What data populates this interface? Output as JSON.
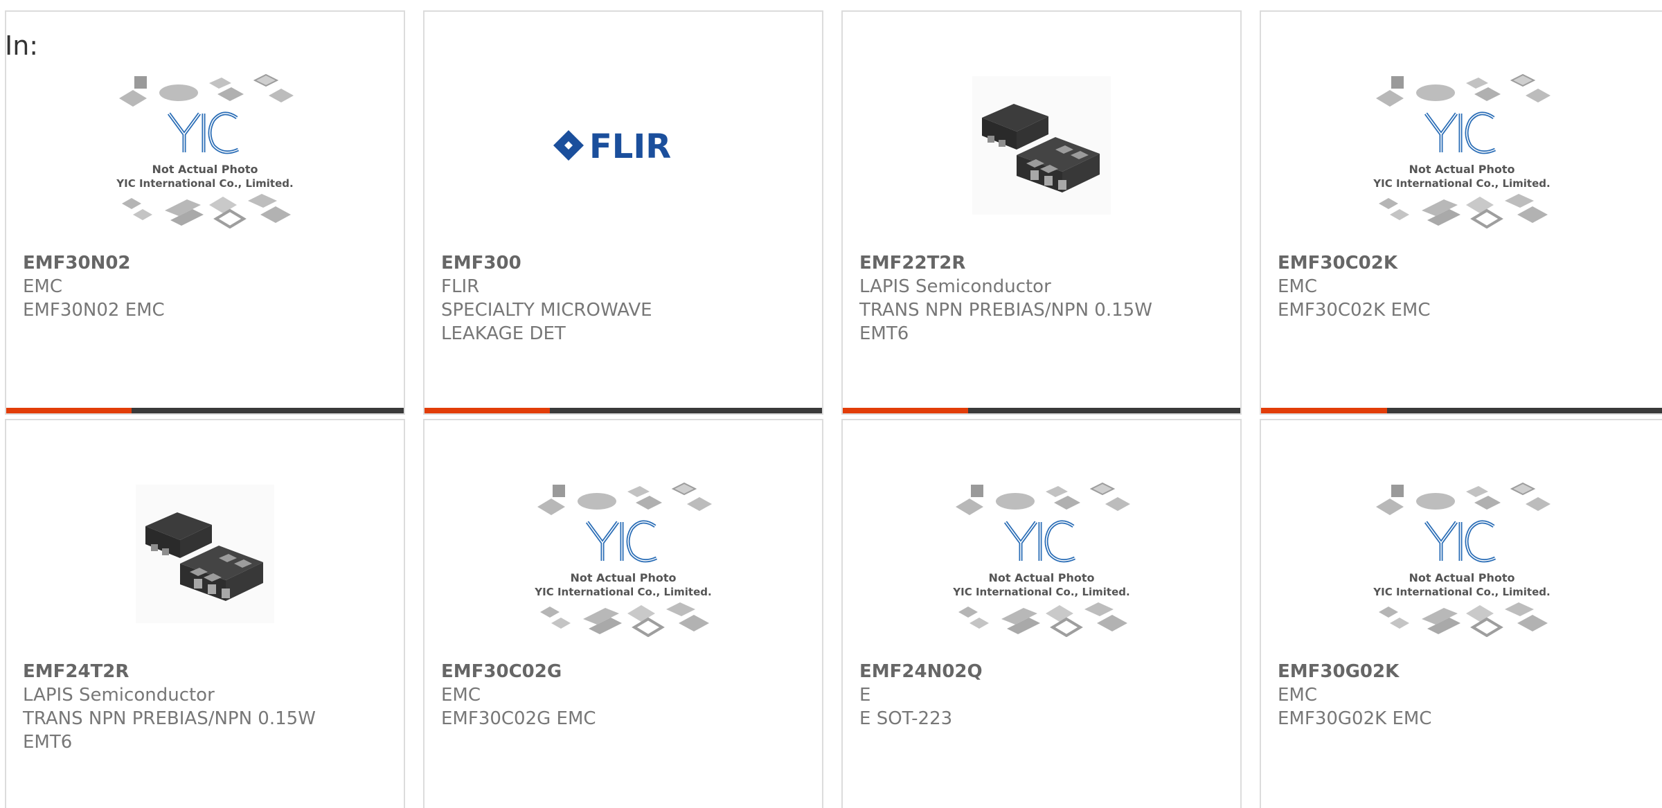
{
  "label_in": "In:",
  "colors": {
    "accent": "#e23d09",
    "bar": "#3a3a3a",
    "border": "#dcdcdc",
    "text": "#777777"
  },
  "placeholder": {
    "line1": "Not Actual Photo",
    "line2": "YIC International Co., Limited.",
    "logo": "YIC"
  },
  "flir_logo_text": "FLIR",
  "cards": [
    {
      "part": "EMF30N02",
      "line1": "EMC",
      "line2": "EMF30N02 EMC",
      "line3": "",
      "image": "yic-placeholder"
    },
    {
      "part": "EMF300",
      "line1": "FLIR",
      "line2": "SPECIALTY MICROWAVE",
      "line3": "LEAKAGE DET",
      "image": "flir-logo"
    },
    {
      "part": "EMF22T2R",
      "line1": "LAPIS Semiconductor",
      "line2": "TRANS NPN PREBIAS/NPN 0.15W",
      "line3": "EMT6",
      "image": "chip-photo"
    },
    {
      "part": "EMF30C02K",
      "line1": "EMC",
      "line2": "EMF30C02K EMC",
      "line3": "",
      "image": "yic-placeholder"
    },
    {
      "part": "EMF24T2R",
      "line1": "LAPIS Semiconductor",
      "line2": "TRANS NPN PREBIAS/NPN 0.15W",
      "line3": "EMT6",
      "image": "chip-photo"
    },
    {
      "part": "EMF30C02G",
      "line1": "EMC",
      "line2": "EMF30C02G EMC",
      "line3": "",
      "image": "yic-placeholder"
    },
    {
      "part": "EMF24N02Q",
      "line1": "E",
      "line2": "E SOT-223",
      "line3": "",
      "image": "yic-placeholder"
    },
    {
      "part": "EMF30G02K",
      "line1": "EMC",
      "line2": "EMF30G02K EMC",
      "line3": "",
      "image": "yic-placeholder"
    }
  ]
}
